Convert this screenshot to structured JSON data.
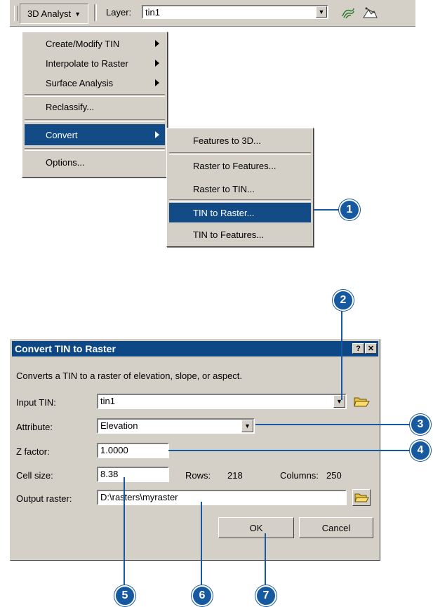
{
  "toolbar": {
    "analyst_label": "3D Analyst",
    "layer_label": "Layer:",
    "layer_value": "tin1"
  },
  "menu": {
    "items": [
      {
        "label": "Create/Modify TIN"
      },
      {
        "label": "Interpolate to Raster"
      },
      {
        "label": "Surface Analysis"
      },
      {
        "label": "Reclassify..."
      },
      {
        "label": "Convert"
      },
      {
        "label": "Options..."
      }
    ]
  },
  "submenu": {
    "items": [
      {
        "label": "Features to 3D..."
      },
      {
        "label": "Raster to Features..."
      },
      {
        "label": "Raster to TIN..."
      },
      {
        "label": "TIN to Raster..."
      },
      {
        "label": "TIN to Features..."
      }
    ]
  },
  "dialog": {
    "title": "Convert TIN to Raster",
    "help_btn": "?",
    "close_btn": "✕",
    "description": "Converts a TIN to a raster of elevation, slope, or aspect.",
    "input_tin_label": "Input TIN:",
    "input_tin_value": "tin1",
    "attribute_label": "Attribute:",
    "attribute_value": "Elevation",
    "zfactor_label": "Z factor:",
    "zfactor_value": "1.0000",
    "cellsize_label": "Cell size:",
    "cellsize_value": "8.38",
    "rows_label": "Rows:",
    "rows_value": "218",
    "columns_label": "Columns:",
    "columns_value": "250",
    "output_label": "Output raster:",
    "output_value": "D:\\rasters\\myraster",
    "ok_label": "OK",
    "cancel_label": "Cancel"
  },
  "callouts": [
    "1",
    "2",
    "3",
    "4",
    "5",
    "6",
    "7"
  ],
  "colors": {
    "callout": "#1659a0",
    "titlebar": "#0d4785",
    "selection": "#124b86",
    "face": "#d4d0c8"
  }
}
